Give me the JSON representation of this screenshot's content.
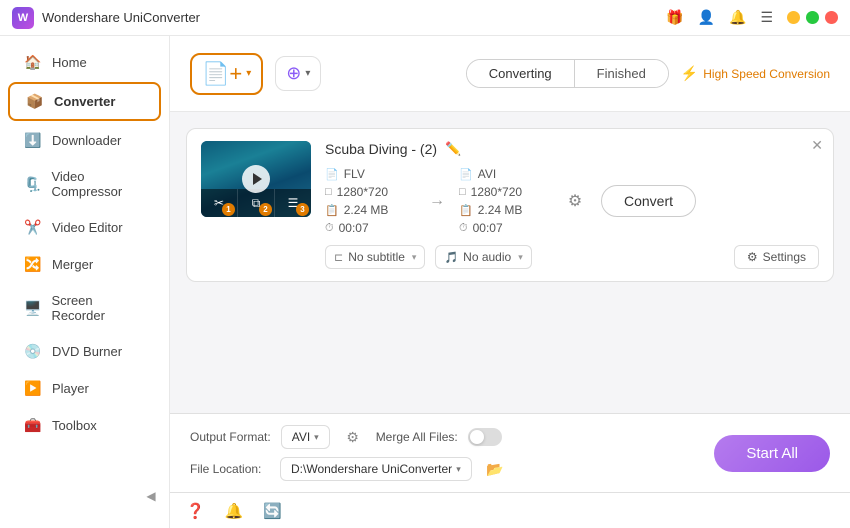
{
  "app": {
    "title": "Wondershare UniConverter",
    "logo_letter": "W"
  },
  "titlebar": {
    "controls": [
      "minimize",
      "maximize",
      "close"
    ],
    "icons": [
      "gift-icon",
      "profile-icon",
      "bell-icon",
      "hamburger-icon"
    ]
  },
  "sidebar": {
    "items": [
      {
        "id": "home",
        "label": "Home",
        "icon": "🏠"
      },
      {
        "id": "converter",
        "label": "Converter",
        "icon": "📦",
        "active": true
      },
      {
        "id": "downloader",
        "label": "Downloader",
        "icon": "⬇️"
      },
      {
        "id": "video-compressor",
        "label": "Video Compressor",
        "icon": "🗜️"
      },
      {
        "id": "video-editor",
        "label": "Video Editor",
        "icon": "✂️"
      },
      {
        "id": "merger",
        "label": "Merger",
        "icon": "🔀"
      },
      {
        "id": "screen-recorder",
        "label": "Screen Recorder",
        "icon": "🖥️"
      },
      {
        "id": "dvd-burner",
        "label": "DVD Burner",
        "icon": "💿"
      },
      {
        "id": "player",
        "label": "Player",
        "icon": "▶️"
      },
      {
        "id": "toolbox",
        "label": "Toolbox",
        "icon": "🧰"
      }
    ],
    "collapse_label": "◀"
  },
  "toolbar": {
    "add_file_label": "Add Files",
    "add_url_label": "Add URLs",
    "tabs": [
      {
        "id": "converting",
        "label": "Converting",
        "active": true
      },
      {
        "id": "finished",
        "label": "Finished",
        "active": false
      }
    ],
    "high_speed_label": "High Speed Conversion"
  },
  "file_card": {
    "title": "Scuba Diving - (2)",
    "source": {
      "format": "FLV",
      "resolution": "1280*720",
      "size": "2.24 MB",
      "duration": "00:07"
    },
    "target": {
      "format": "AVI",
      "resolution": "1280*720",
      "size": "2.24 MB",
      "duration": "00:07"
    },
    "subtitle_label": "No subtitle",
    "audio_label": "No audio",
    "settings_label": "Settings",
    "convert_label": "Convert",
    "tools": [
      {
        "id": "scissors",
        "symbol": "✂",
        "badge": "1"
      },
      {
        "id": "crop",
        "symbol": "⧉",
        "badge": "2"
      },
      {
        "id": "effects",
        "symbol": "☰",
        "badge": "3"
      }
    ]
  },
  "footer": {
    "output_format_label": "Output Format:",
    "output_format_value": "AVI",
    "file_location_label": "File Location:",
    "file_location_value": "D:\\Wondershare UniConverter",
    "merge_files_label": "Merge All Files:",
    "start_all_label": "Start All"
  },
  "statusbar": {
    "icons": [
      "help-icon",
      "bell-icon",
      "sync-icon"
    ]
  }
}
